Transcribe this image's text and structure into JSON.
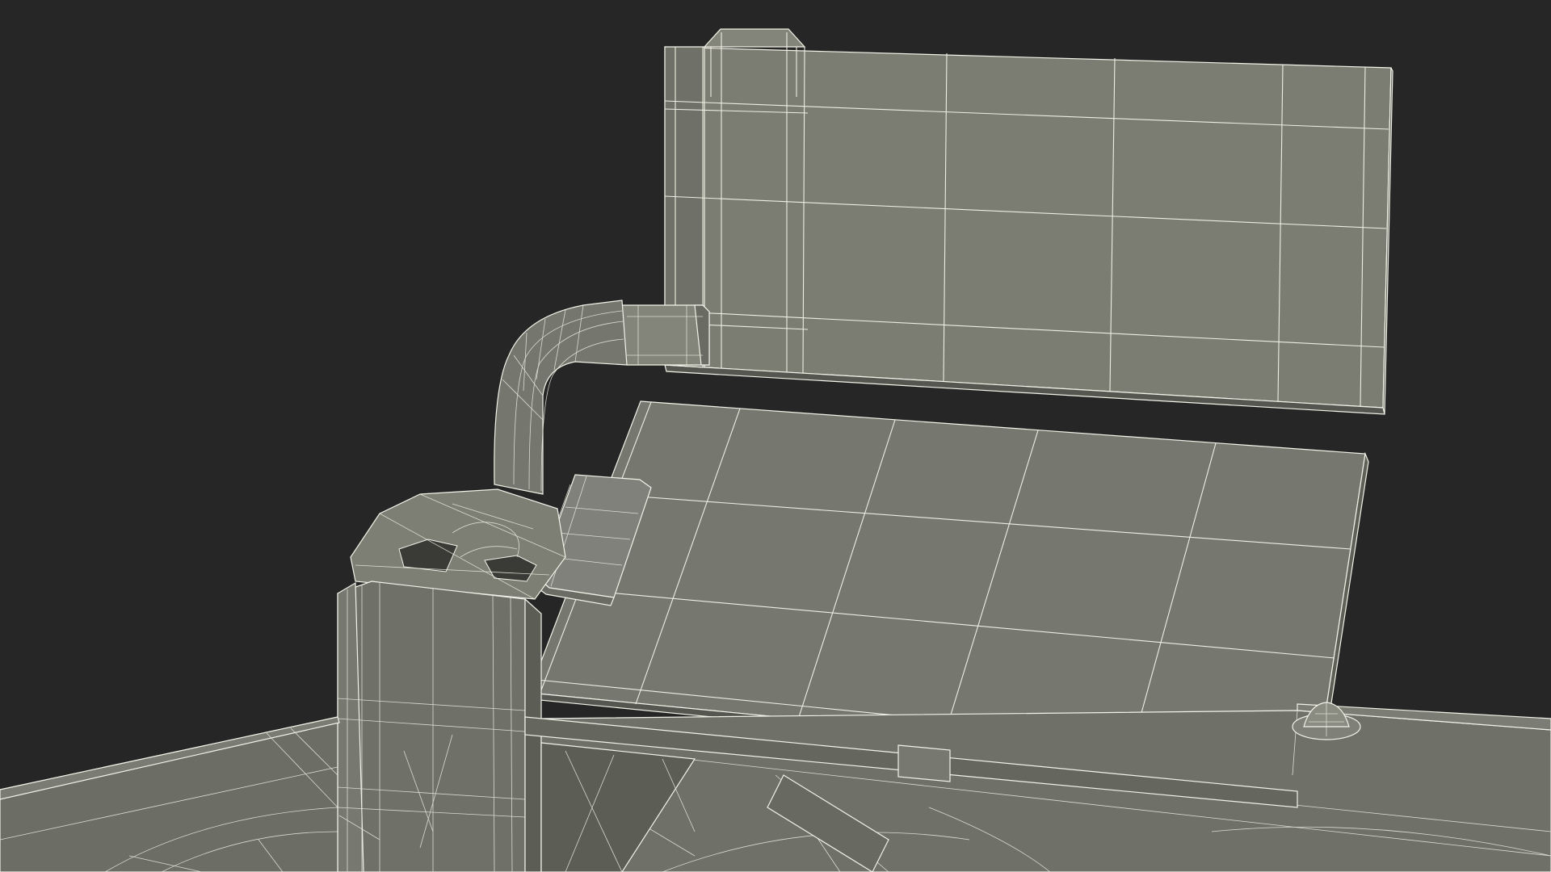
{
  "scene": {
    "background_color": "#262626",
    "mesh_fill_light": "#7b7c72",
    "mesh_fill_mid": "#72736a",
    "mesh_fill_dark": "#5f6058",
    "wire_color": "#f2f2e8"
  }
}
